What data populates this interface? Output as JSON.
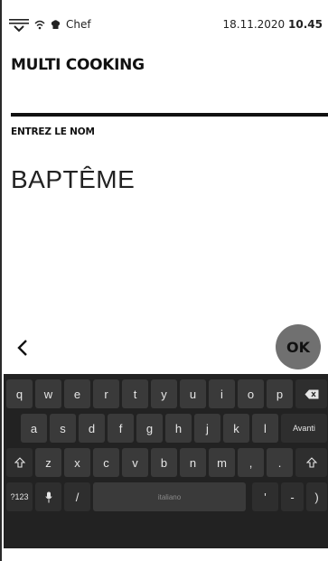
{
  "status": {
    "app_label": "Chef",
    "date": "18.11.2020",
    "time": "10.45"
  },
  "header": {
    "title": "MULTI COOKING"
  },
  "form": {
    "label": "ENTREZ LE NOM",
    "value": "BAPTÊME"
  },
  "actions": {
    "ok_label": "OK",
    "back_icon": "chevron-left-icon"
  },
  "keyboard": {
    "row1": [
      "q",
      "w",
      "e",
      "r",
      "t",
      "y",
      "u",
      "i",
      "o",
      "p"
    ],
    "row2": [
      "a",
      "s",
      "d",
      "f",
      "g",
      "h",
      "j",
      "k",
      "l"
    ],
    "row2_end": "Avanti",
    "row3": [
      "z",
      "x",
      "c",
      "v",
      "b",
      "n",
      "m",
      ",",
      "."
    ],
    "row4": {
      "symbols": "?123",
      "slash": "/",
      "space": "italiano",
      "apostrophe": "'",
      "dash": "-",
      "paren": ")"
    }
  }
}
